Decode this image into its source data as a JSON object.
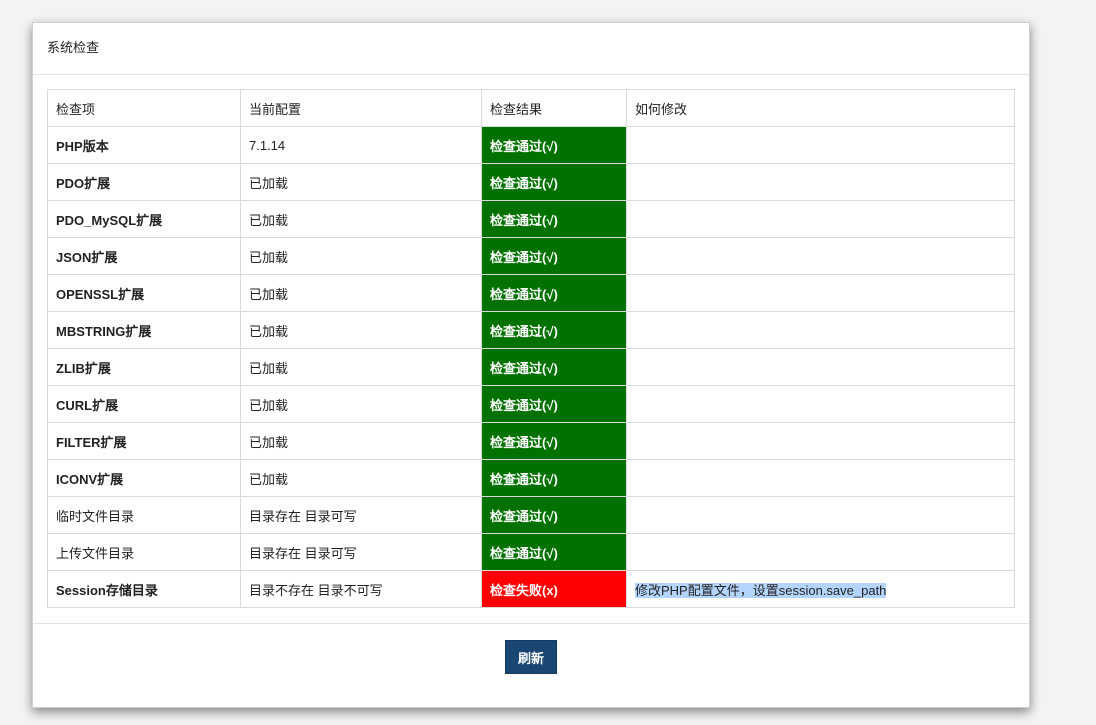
{
  "panel": {
    "title": "系统检查"
  },
  "table": {
    "headers": [
      "检查项",
      "当前配置",
      "检查结果",
      "如何修改"
    ],
    "rows": [
      {
        "item": "PHP版本",
        "current": "7.1.14",
        "result": "检查通过(√)",
        "status": "pass",
        "fix": "",
        "bold": true
      },
      {
        "item": "PDO扩展",
        "current": "已加载",
        "result": "检查通过(√)",
        "status": "pass",
        "fix": "",
        "bold": true
      },
      {
        "item": "PDO_MySQL扩展",
        "current": "已加载",
        "result": "检查通过(√)",
        "status": "pass",
        "fix": "",
        "bold": true
      },
      {
        "item": "JSON扩展",
        "current": "已加载",
        "result": "检查通过(√)",
        "status": "pass",
        "fix": "",
        "bold": true
      },
      {
        "item": "OPENSSL扩展",
        "current": "已加载",
        "result": "检查通过(√)",
        "status": "pass",
        "fix": "",
        "bold": true
      },
      {
        "item": "MBSTRING扩展",
        "current": "已加载",
        "result": "检查通过(√)",
        "status": "pass",
        "fix": "",
        "bold": true
      },
      {
        "item": "ZLIB扩展",
        "current": "已加载",
        "result": "检查通过(√)",
        "status": "pass",
        "fix": "",
        "bold": true
      },
      {
        "item": "CURL扩展",
        "current": "已加载",
        "result": "检查通过(√)",
        "status": "pass",
        "fix": "",
        "bold": true
      },
      {
        "item": "FILTER扩展",
        "current": "已加载",
        "result": "检查通过(√)",
        "status": "pass",
        "fix": "",
        "bold": true
      },
      {
        "item": "ICONV扩展",
        "current": "已加载",
        "result": "检查通过(√)",
        "status": "pass",
        "fix": "",
        "bold": true
      },
      {
        "item": "临时文件目录",
        "current": "目录存在 目录可写",
        "result": "检查通过(√)",
        "status": "pass",
        "fix": "",
        "bold": false
      },
      {
        "item": "上传文件目录",
        "current": "目录存在 目录可写",
        "result": "检查通过(√)",
        "status": "pass",
        "fix": "",
        "bold": false
      },
      {
        "item": "Session存储目录",
        "current": "目录不存在 目录不可写",
        "result": "检查失败(x)",
        "status": "fail",
        "fix": "修改PHP配置文件，设置session.save_path",
        "bold": true
      }
    ]
  },
  "footer": {
    "refresh_label": "刷新"
  },
  "colors": {
    "pass": "#037100",
    "fail": "#ff0000",
    "button": "#1a4674"
  }
}
